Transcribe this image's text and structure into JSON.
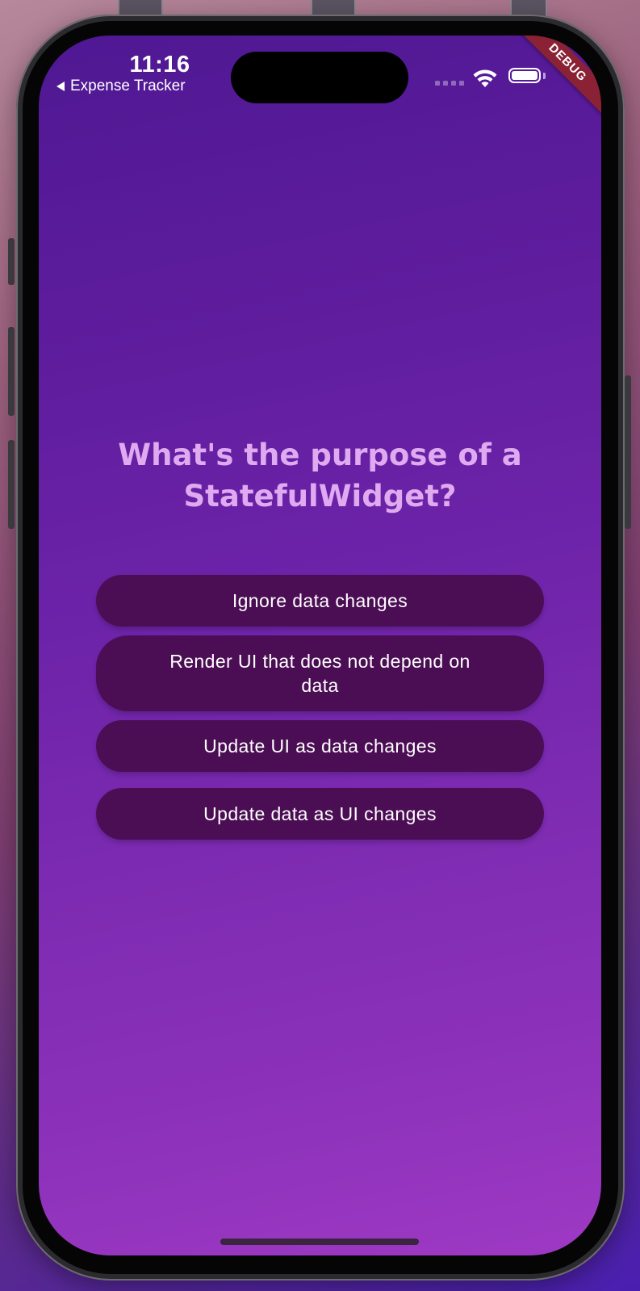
{
  "status_bar": {
    "time": "11:16",
    "back_app": "Expense Tracker",
    "signal_icon": "cellular-signal-icon",
    "wifi_icon": "wifi-icon",
    "battery_icon": "battery-icon"
  },
  "debug_banner": {
    "label": "DEBUG",
    "color": "#8a2134"
  },
  "quiz": {
    "question": "What's the purpose of a StatefulWidget?",
    "answers": [
      "Ignore data changes",
      "Render UI that does not depend on data",
      "Update UI as data changes",
      "Update data as UI changes"
    ]
  },
  "colors": {
    "background_top": "#4f1893",
    "background_bottom": "#9e39c4",
    "question_text": "#dfaaf0",
    "answer_button": "#4b0e54"
  }
}
